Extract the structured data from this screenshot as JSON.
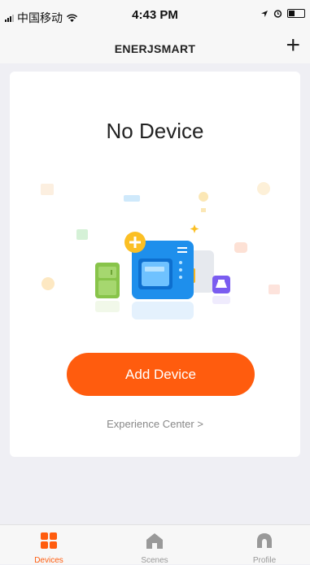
{
  "status_bar": {
    "carrier": "中国移动",
    "time": "4:43 PM",
    "icons": [
      "signal-icon",
      "wifi-icon",
      "location-icon",
      "alarm-icon",
      "battery-icon"
    ]
  },
  "header": {
    "title": "ENERJSMART",
    "add_icon": "plus-icon"
  },
  "main": {
    "empty_title": "No Device",
    "add_button_label": "Add Device",
    "experience_link": "Experience Center >"
  },
  "tabs": [
    {
      "label": "Devices",
      "icon": "devices-icon",
      "active": true
    },
    {
      "label": "Scenes",
      "icon": "house-icon",
      "active": false
    },
    {
      "label": "Profile",
      "icon": "profile-icon",
      "active": false
    }
  ],
  "colors": {
    "accent": "#ff5c0e",
    "inactive": "#999999"
  }
}
